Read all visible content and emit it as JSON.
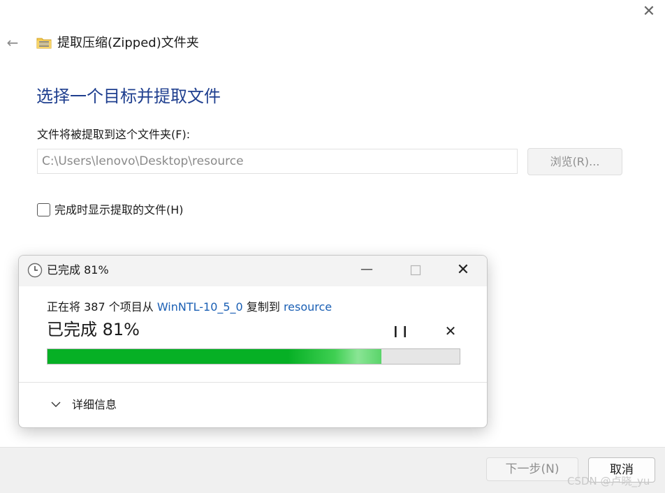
{
  "wizard": {
    "title": "提取压缩(Zipped)文件夹",
    "heading": "选择一个目标并提取文件",
    "destination_label": "文件将被提取到这个文件夹(F):",
    "destination_value": "C:\\Users\\lenovo\\Desktop\\resource",
    "browse_label": "浏览(R)...",
    "show_files_label": "完成时显示提取的文件(H)",
    "show_files_checked": false,
    "next_label": "下一步(N)",
    "cancel_label": "取消"
  },
  "progress_dialog": {
    "title": "已完成 81%",
    "copy_prefix": "正在将 387 个项目从",
    "source": "WinNTL-10_5_0",
    "copy_middle": "复制到",
    "destination": "resource",
    "progress_label": "已完成 81%",
    "percent": 81,
    "details_label": "详细信息"
  },
  "watermark": "CSDN @卢晓_yu",
  "colors": {
    "heading": "#1f3f8f",
    "link": "#1a5fb4",
    "progress_fill": "#06b025"
  },
  "icons": [
    "back-arrow-icon",
    "zip-folder-icon",
    "close-icon",
    "clock-icon",
    "minimize-icon",
    "maximize-icon",
    "pause-icon",
    "stop-icon",
    "chevron-down-icon"
  ]
}
